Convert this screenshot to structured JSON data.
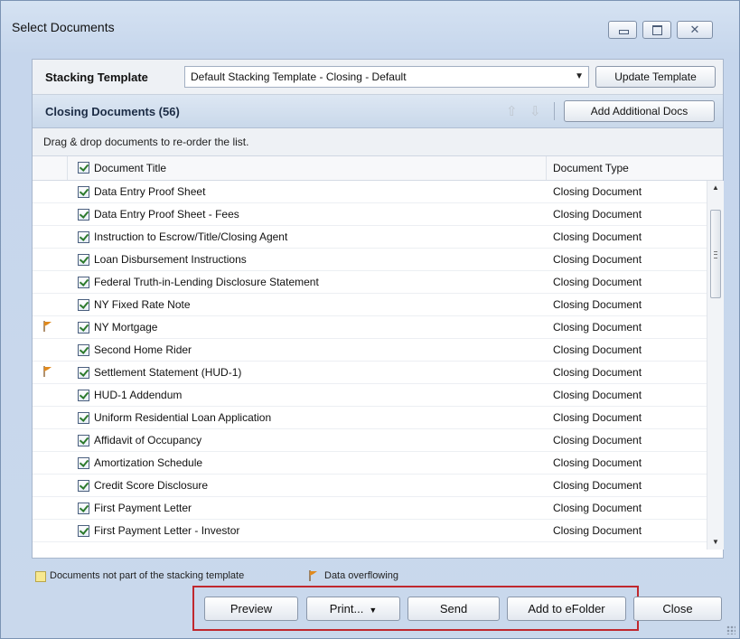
{
  "window": {
    "title": "Select Documents",
    "close_glyph": "✕"
  },
  "stacking": {
    "label": "Stacking Template",
    "selected": "Default Stacking Template - Closing - Default",
    "update_button": "Update Template"
  },
  "closing": {
    "title": "Closing Documents (56)",
    "add_button": "Add Additional Docs",
    "hint": "Drag & drop documents to re-order the list."
  },
  "grid": {
    "headers": {
      "title": "Document Title",
      "type": "Document Type"
    },
    "rows": [
      {
        "title": "Data Entry Proof Sheet",
        "type": "Closing Document",
        "flag": false
      },
      {
        "title": "Data Entry Proof Sheet - Fees",
        "type": "Closing Document",
        "flag": false
      },
      {
        "title": "Instruction to Escrow/Title/Closing Agent",
        "type": "Closing Document",
        "flag": false
      },
      {
        "title": "Loan Disbursement Instructions",
        "type": "Closing Document",
        "flag": false
      },
      {
        "title": "Federal Truth-in-Lending Disclosure Statement",
        "type": "Closing Document",
        "flag": false
      },
      {
        "title": "NY Fixed Rate Note",
        "type": "Closing Document",
        "flag": false
      },
      {
        "title": "NY Mortgage",
        "type": "Closing Document",
        "flag": true
      },
      {
        "title": "Second Home Rider",
        "type": "Closing Document",
        "flag": false
      },
      {
        "title": "Settlement Statement (HUD-1)",
        "type": "Closing Document",
        "flag": true
      },
      {
        "title": "HUD-1 Addendum",
        "type": "Closing Document",
        "flag": false
      },
      {
        "title": "Uniform Residential Loan Application",
        "type": "Closing Document",
        "flag": false
      },
      {
        "title": "Affidavit of Occupancy",
        "type": "Closing Document",
        "flag": false
      },
      {
        "title": "Amortization Schedule",
        "type": "Closing Document",
        "flag": false
      },
      {
        "title": "Credit Score Disclosure",
        "type": "Closing Document",
        "flag": false
      },
      {
        "title": "First Payment Letter",
        "type": "Closing Document",
        "flag": false
      },
      {
        "title": "First Payment Letter - Investor",
        "type": "Closing Document",
        "flag": false
      }
    ]
  },
  "legend": {
    "not_in_template": "Documents not part of the stacking template",
    "overflow": "Data overflowing"
  },
  "buttons": {
    "preview": "Preview",
    "print": "Print...",
    "send": "Send",
    "add_efolder": "Add to eFolder",
    "close": "Close"
  },
  "colors": {
    "flag": "#e08a1e",
    "highlight": "#c0282e",
    "legend_swatch": "#f7e890"
  }
}
